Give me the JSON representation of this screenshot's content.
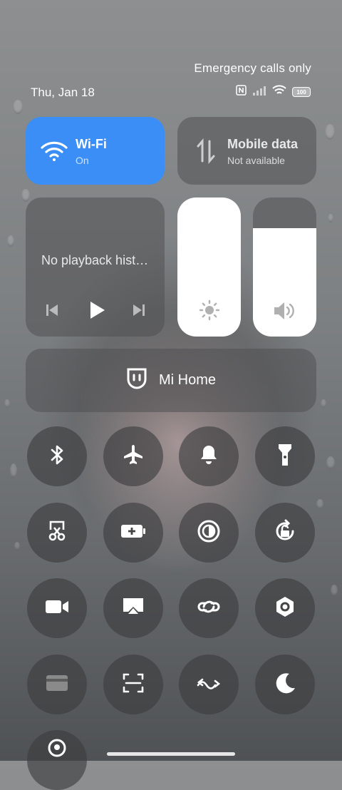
{
  "status": {
    "carrier_text": "Emergency calls only",
    "date": "Thu, Jan 18",
    "battery": "100",
    "icons": [
      "nfc-icon",
      "signal-icon",
      "wifi-status-icon",
      "battery-icon"
    ]
  },
  "wifi": {
    "title": "Wi-Fi",
    "subtitle": "On",
    "accent": "#3b8ef6"
  },
  "mobile_data": {
    "title": "Mobile data",
    "subtitle": "Not available"
  },
  "media": {
    "text": "No playback hist…"
  },
  "brightness": {
    "level": 1.0
  },
  "volume": {
    "level": 0.78
  },
  "mi_home": {
    "label": "Mi Home"
  },
  "toggles": [
    {
      "name": "bluetooth-icon",
      "active": false
    },
    {
      "name": "airplane-mode-icon",
      "active": false
    },
    {
      "name": "bell-icon",
      "active": false
    },
    {
      "name": "flashlight-icon",
      "active": false
    },
    {
      "name": "screenshot-icon",
      "active": false
    },
    {
      "name": "battery-saver-icon",
      "active": false
    },
    {
      "name": "reading-mode-icon",
      "active": false
    },
    {
      "name": "rotation-lock-icon",
      "active": false
    },
    {
      "name": "screen-record-icon",
      "active": false
    },
    {
      "name": "cast-icon",
      "active": false
    },
    {
      "name": "link-icon",
      "active": false
    },
    {
      "name": "hexagon-icon",
      "active": false
    },
    {
      "name": "card-icon",
      "active": false
    },
    {
      "name": "scanner-icon",
      "active": false
    },
    {
      "name": "sync-icon",
      "active": false
    },
    {
      "name": "dark-mode-icon",
      "active": false
    },
    {
      "name": "location-icon",
      "active": false
    }
  ]
}
